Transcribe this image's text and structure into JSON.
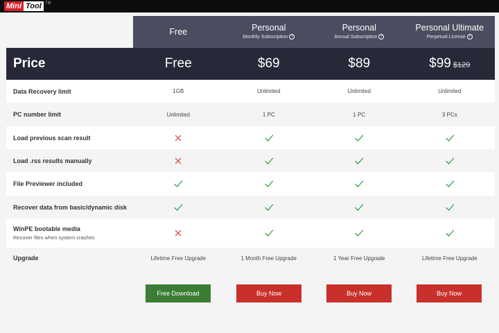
{
  "brand": {
    "mini": "Mini",
    "tool": "Tool",
    "tm": "TM"
  },
  "plans": [
    {
      "name": "Free",
      "sub": ""
    },
    {
      "name": "Personal",
      "sub": "Monthly Subscription"
    },
    {
      "name": "Personal",
      "sub": "Annual Subscription"
    },
    {
      "name": "Personal Ultimate",
      "sub": "Perpetual License"
    }
  ],
  "price": {
    "label": "Price",
    "values": [
      "Free",
      "$69",
      "$89",
      "$99"
    ],
    "old_price": "$129"
  },
  "features": [
    {
      "label": "Data Recovery limit",
      "note": "",
      "cells": [
        {
          "text": "1GB"
        },
        {
          "text": "Unlimited"
        },
        {
          "text": "Unlimited"
        },
        {
          "text": "Unlimited"
        }
      ]
    },
    {
      "label": "PC number limit",
      "note": "",
      "cells": [
        {
          "text": "Unlimited"
        },
        {
          "text": "1 PC"
        },
        {
          "text": "1 PC"
        },
        {
          "text": "3 PCs"
        }
      ]
    },
    {
      "label": "Load previous scan result",
      "note": "",
      "cells": [
        {
          "icon": "cross-icon"
        },
        {
          "icon": "check-icon"
        },
        {
          "icon": "check-icon"
        },
        {
          "icon": "check-icon"
        }
      ]
    },
    {
      "label": "Load .rss results manually",
      "note": "",
      "cells": [
        {
          "icon": "cross-icon"
        },
        {
          "icon": "check-icon"
        },
        {
          "icon": "check-icon"
        },
        {
          "icon": "check-icon"
        }
      ]
    },
    {
      "label": "File Previewer included",
      "note": "",
      "cells": [
        {
          "icon": "check-icon"
        },
        {
          "icon": "check-icon"
        },
        {
          "icon": "check-icon"
        },
        {
          "icon": "check-icon"
        }
      ]
    },
    {
      "label": "Recover data from basic/dynamic disk",
      "note": "",
      "cells": [
        {
          "icon": "check-icon"
        },
        {
          "icon": "check-icon"
        },
        {
          "icon": "check-icon"
        },
        {
          "icon": "check-icon"
        }
      ]
    },
    {
      "label": "WinPE bootable media",
      "note": "Recover files when system crashes",
      "cells": [
        {
          "icon": "cross-icon"
        },
        {
          "icon": "check-icon"
        },
        {
          "icon": "check-icon"
        },
        {
          "icon": "check-icon"
        }
      ]
    },
    {
      "label": "Upgrade",
      "note": "",
      "cells": [
        {
          "text": "Lifetime Free Upgrade"
        },
        {
          "text": "1 Month Free Upgrade"
        },
        {
          "text": "1 Year Free Upgrade"
        },
        {
          "text": "Lifetime Free Upgrade"
        }
      ]
    }
  ],
  "buttons": {
    "free_download": "Free Download",
    "buy_now": "Buy Now"
  },
  "colors": {
    "header_bg": "#4b4c5f",
    "price_bg": "#272838",
    "check": "#3aa14a",
    "cross": "#e04646",
    "download_btn": "#3b7d34",
    "buy_btn": "#c9302c"
  }
}
